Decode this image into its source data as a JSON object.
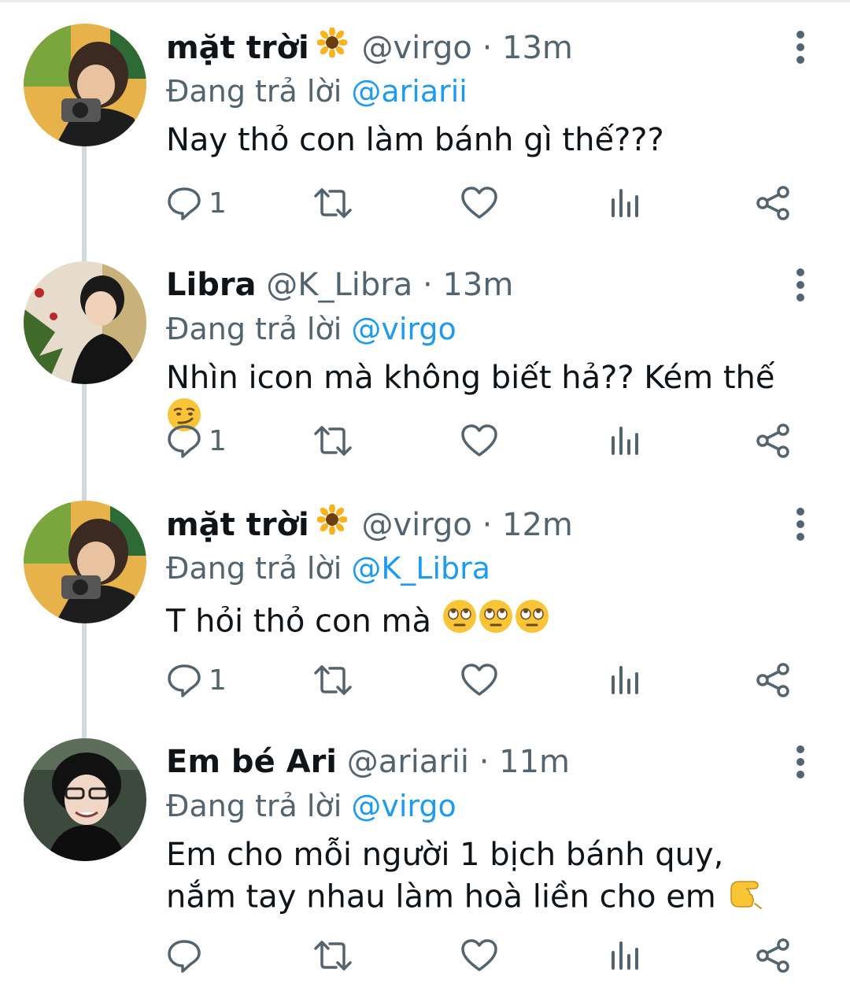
{
  "colors": {
    "accent": "#1d9bf0",
    "secondary": "#536471",
    "thread_line": "#cfd9de",
    "emoji": "#f9c436"
  },
  "tweets": [
    {
      "name": "mặt trời",
      "name_emoji": "sunflower",
      "handle": "@virgo",
      "separator": "·",
      "time": "13m",
      "replying_prefix": "Đang trả lời",
      "replying_to": "@ariarii",
      "text": "Nay thỏ con làm bánh gì thế???",
      "text_emojis": [],
      "reply_count": "1"
    },
    {
      "name": "Libra",
      "name_emoji": "",
      "handle": "@K_Libra",
      "separator": "·",
      "time": "13m",
      "replying_prefix": "Đang trả lời",
      "replying_to": "@virgo",
      "text": "Nhìn icon mà không biết hả?? Kém thế",
      "text_emojis": [
        "smirking-face"
      ],
      "reply_count": "1"
    },
    {
      "name": "mặt trời",
      "name_emoji": "sunflower",
      "handle": "@virgo",
      "separator": "·",
      "time": "12m",
      "replying_prefix": "Đang trả lời",
      "replying_to": "@K_Libra",
      "text": "T hỏi thỏ con mà",
      "text_emojis": [
        "face-with-rolling-eyes",
        "face-with-rolling-eyes",
        "face-with-rolling-eyes"
      ],
      "reply_count": "1"
    },
    {
      "name": "Em bé Ari",
      "name_emoji": "",
      "handle": "@ariarii",
      "separator": "·",
      "time": "11m",
      "replying_prefix": "Đang trả lời",
      "replying_to": "@virgo",
      "text": "Em cho mỗi người 1 bịch bánh quy, nắm tay nhau làm hoà liền cho em",
      "text_emojis": [
        "backhand-pointing-hand"
      ],
      "reply_count": ""
    }
  ]
}
